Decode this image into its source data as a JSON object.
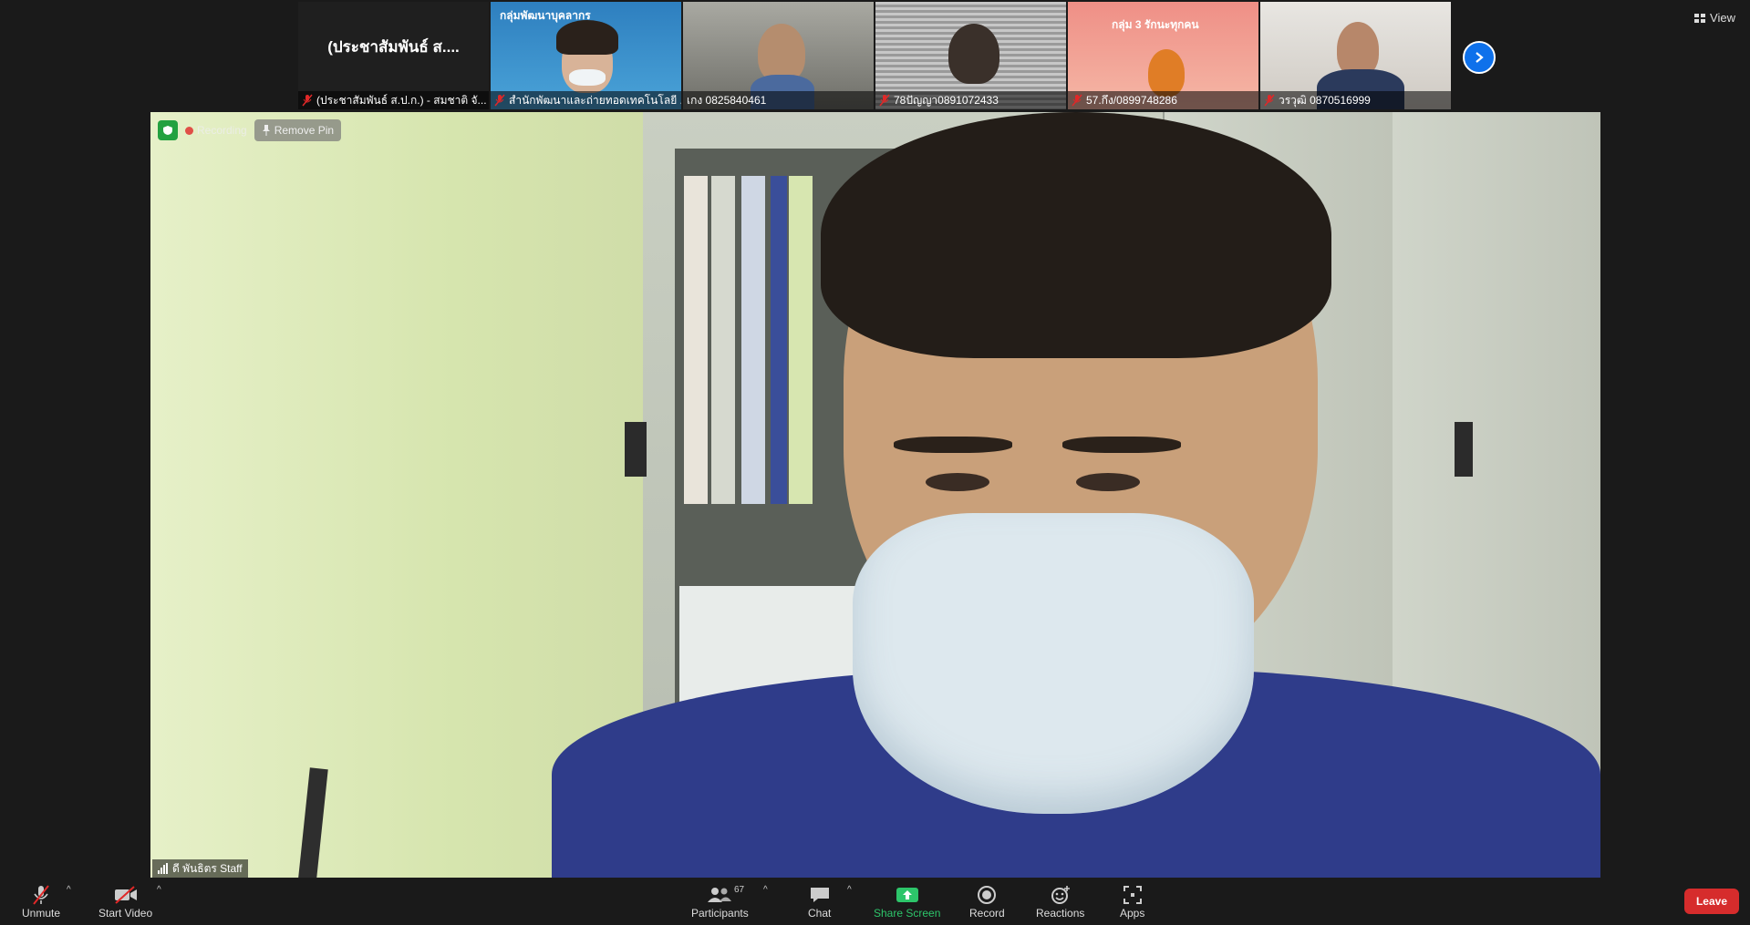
{
  "top_strip": {
    "tiles": [
      {
        "kind": "name",
        "display_name": "(ประชาสัมพันธ์ ส....",
        "label": "(ประชาสัมพันธ์ ส.ป.ก.) - สมชาติ จั..."
      },
      {
        "kind": "video",
        "overlay_text": "กลุ่มพัฒนาบุคลากร",
        "label": "สำนักพัฒนาและถ่ายทอดเทคโนโลยี ..."
      },
      {
        "kind": "video",
        "label": "เกง 0825840461"
      },
      {
        "kind": "video",
        "label": "78ปัญญา0891072433"
      },
      {
        "kind": "video",
        "overlay_text": "กลุ่ม 3 รักนะทุกคน",
        "label": "57.กึง/0899748286"
      },
      {
        "kind": "video",
        "label": "วรวุฒิ 0870516999"
      }
    ],
    "next_icon": "chevron-right-icon",
    "view_label": "View"
  },
  "main_video": {
    "recording_label": "Recording",
    "remove_pin_label": "Remove Pin",
    "speaker_name": "ดี พันธิตร Staff"
  },
  "toolbar": {
    "unmute": "Unmute",
    "start_video": "Start Video",
    "participants": "Participants",
    "participants_count": "67",
    "chat": "Chat",
    "share_screen": "Share Screen",
    "record": "Record",
    "reactions": "Reactions",
    "apps": "Apps",
    "leave": "Leave"
  },
  "colors": {
    "accent": "#0e71eb",
    "share_green": "#2dc56a",
    "leave_red": "#d62c2c",
    "mute_red": "#e02828"
  }
}
